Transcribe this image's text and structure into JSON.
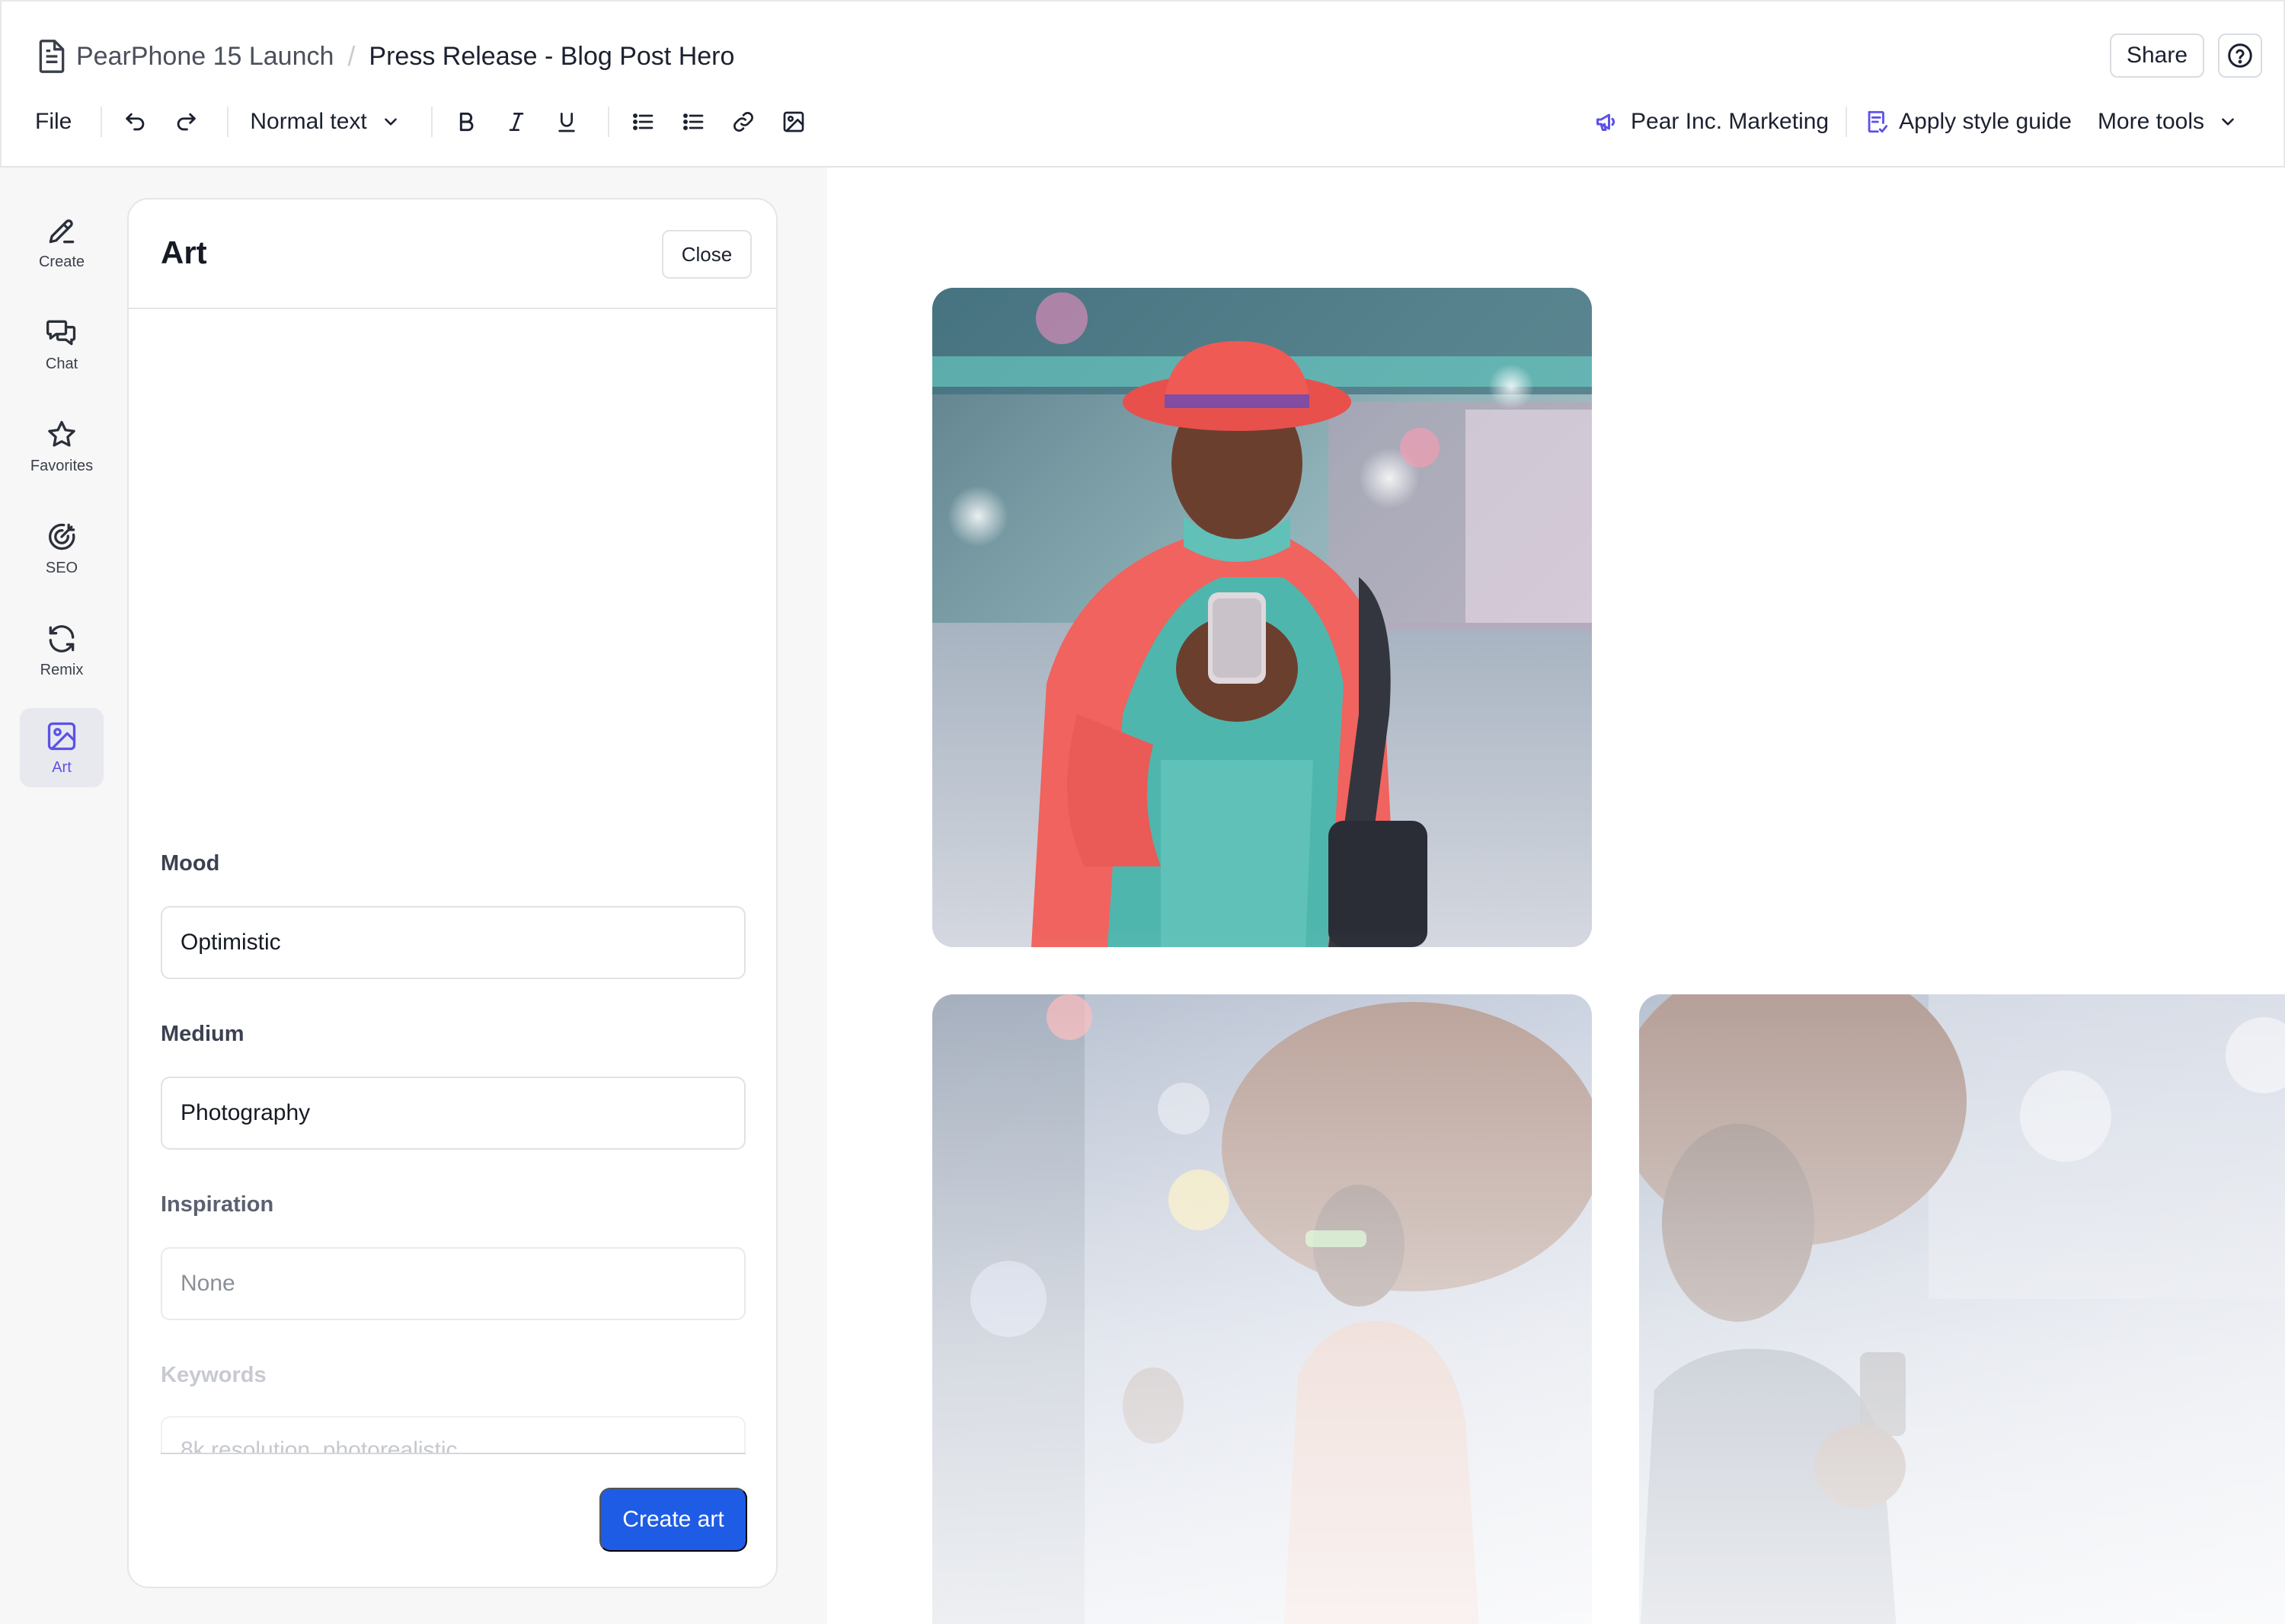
{
  "header": {
    "project": "PearPhone 15 Launch",
    "separator": "/",
    "document": "Press Release - Blog Post Hero",
    "share_label": "Share"
  },
  "toolbar": {
    "file_label": "File",
    "text_style": "Normal text",
    "brand_label": "Pear Inc. Marketing",
    "apply_style_label": "Apply style guide",
    "more_tools_label": "More tools",
    "accent_color": "#5b52e8"
  },
  "sidebar": {
    "items": [
      {
        "label": "Create",
        "icon": "pen-icon"
      },
      {
        "label": "Chat",
        "icon": "chat-bubbles-icon"
      },
      {
        "label": "Favorites",
        "icon": "star-icon"
      },
      {
        "label": "SEO",
        "icon": "target-icon"
      },
      {
        "label": "Remix",
        "icon": "refresh-icon"
      },
      {
        "label": "Art",
        "icon": "image-icon",
        "active": true
      }
    ]
  },
  "panel": {
    "title": "Art",
    "close_label": "Close",
    "mood": {
      "label": "Mood",
      "value": "Optimistic"
    },
    "medium": {
      "label": "Medium",
      "value": "Photography"
    },
    "inspiration": {
      "label": "Inspiration",
      "placeholder": "None"
    },
    "keywords": {
      "label": "Keywords",
      "placeholder": "8k resolution, photorealistic"
    },
    "create_label": "Create art",
    "button_color": "#1f5ce5"
  },
  "canvas": {
    "images": [
      {
        "subject": "woman-red-hat-phone-photo"
      },
      {
        "subject": "woman-afro-phone-photo"
      },
      {
        "subject": "man-afro-phone-photo"
      }
    ]
  }
}
